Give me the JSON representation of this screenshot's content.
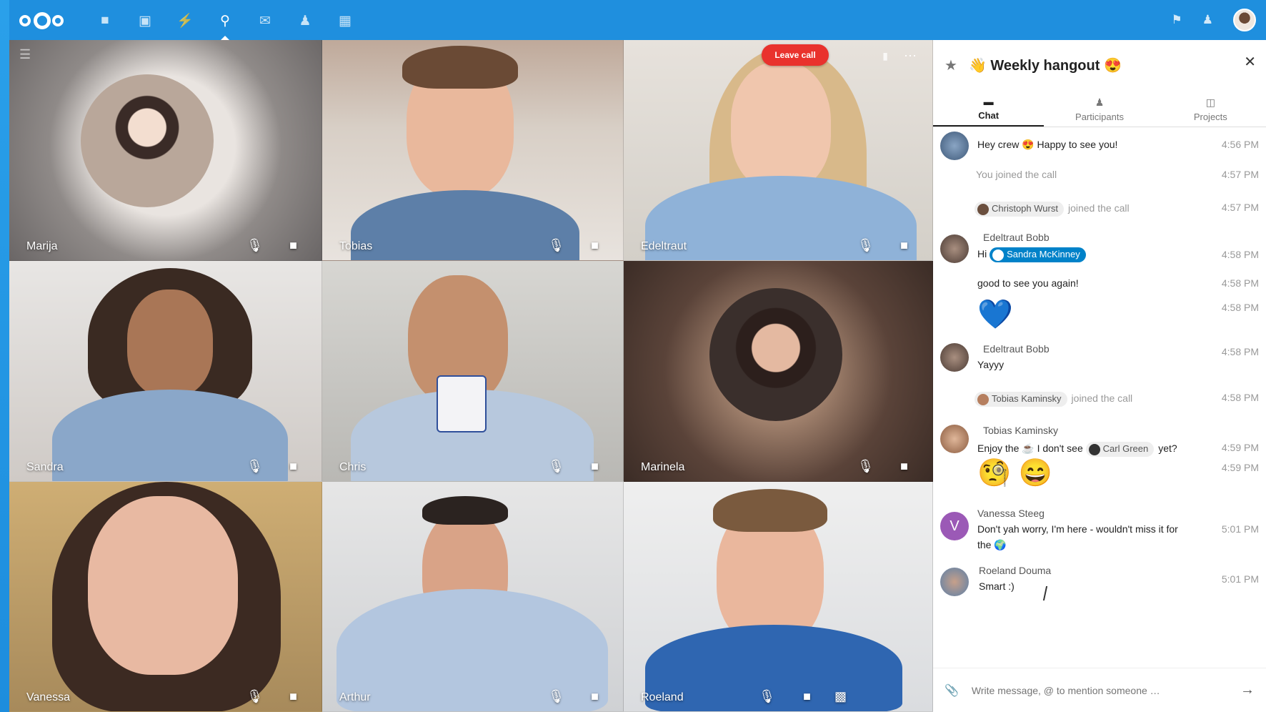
{
  "topbar": {
    "nav": [
      "files-icon",
      "photos-icon",
      "activity-icon",
      "talk-icon",
      "mail-icon",
      "contacts-icon",
      "calendar-icon"
    ],
    "active": "talk-icon"
  },
  "call": {
    "leave_label": "Leave call",
    "tiles": [
      {
        "name": "Marija"
      },
      {
        "name": "Tobias"
      },
      {
        "name": "Edeltraut"
      },
      {
        "name": "Sandra"
      },
      {
        "name": "Chris"
      },
      {
        "name": "Marinela"
      },
      {
        "name": "Vanessa"
      },
      {
        "name": "Arthur"
      },
      {
        "name": "Roeland"
      }
    ]
  },
  "sidebar": {
    "title": "Weekly hangout",
    "tabs": [
      {
        "label": "Chat",
        "active": true
      },
      {
        "label": "Participants",
        "active": false
      },
      {
        "label": "Projects",
        "active": false
      }
    ],
    "messages": {
      "m1": {
        "text": "Hey crew 😍 Happy to see you!",
        "time": "4:56 PM"
      },
      "m2": {
        "text": "You joined the call",
        "time": "4:57 PM"
      },
      "m3": {
        "chip": "Christoph Wurst",
        "text": "joined the call",
        "time": "4:57 PM"
      },
      "m4": {
        "author": "Edeltraut Bobb",
        "prefix": "Hi",
        "chip": "Sandra McKinney",
        "time": "4:58 PM"
      },
      "m5": {
        "text": "good to see you again!",
        "time": "4:58 PM"
      },
      "m6": {
        "emoji": "💙",
        "time": "4:58 PM"
      },
      "m7": {
        "author": "Edeltraut Bobb",
        "text": "Yayyy",
        "time": "4:58 PM"
      },
      "m8": {
        "chip": "Tobias Kaminsky",
        "text": "joined the call",
        "time": "4:58 PM"
      },
      "m9": {
        "author": "Tobias Kaminsky",
        "prefix": "Enjoy the ☕ I don't see",
        "chip": "Carl Green",
        "suffix": "yet?",
        "time": "4:59 PM"
      },
      "m10": {
        "emoji": "🧐 😄",
        "time": "4:59 PM"
      },
      "m11": {
        "author": "Vanessa Steeg",
        "avatar_letter": "V",
        "text": "Don't yah worry, I'm here - wouldn't miss it for",
        "text2": "the 🌍",
        "time": "5:01 PM"
      },
      "m12": {
        "author": "Roeland Douma",
        "text": "Smart :)",
        "time": "5:01 PM"
      }
    },
    "composer": {
      "placeholder": "Write message, @ to mention someone …"
    }
  },
  "colors": {
    "brand": "#0082c9",
    "leave": "#e9322d",
    "vanessa": "#9b59b6"
  }
}
